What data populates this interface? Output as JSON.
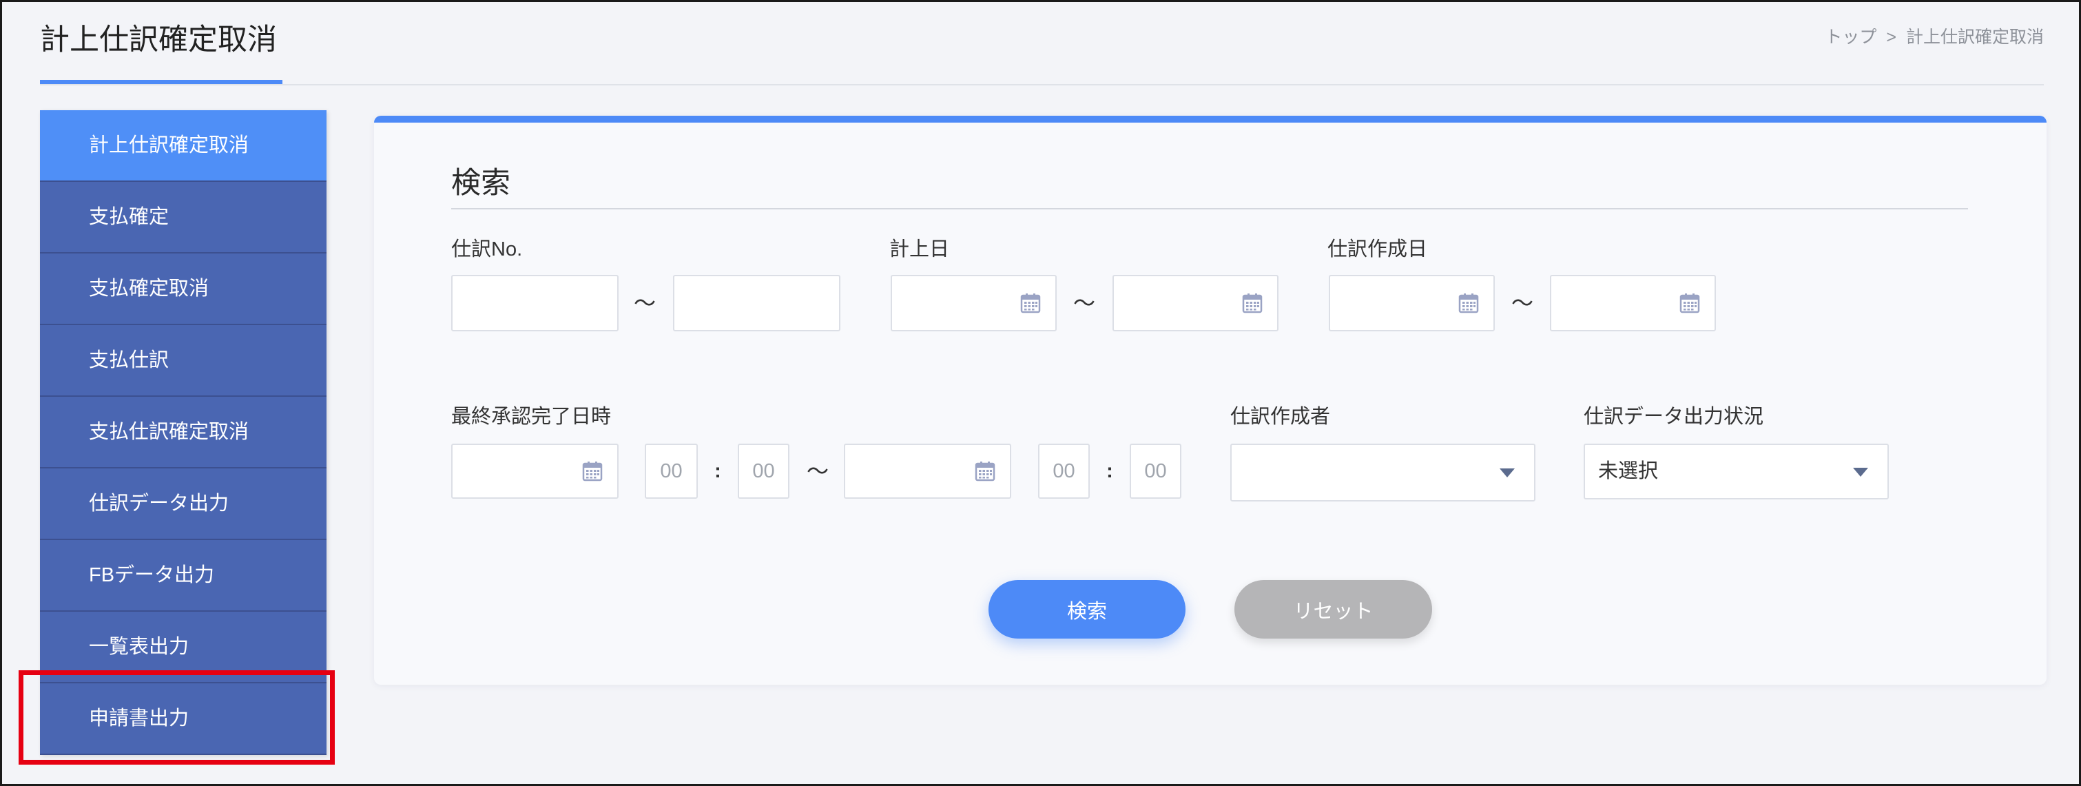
{
  "header": {
    "title": "計上仕訳確定取消",
    "breadcrumb": {
      "home": "トップ",
      "separator": ">",
      "current": "計上仕訳確定取消"
    }
  },
  "sidebar": {
    "items": [
      {
        "label": "計上仕訳確定取消",
        "active": true
      },
      {
        "label": "支払確定",
        "active": false
      },
      {
        "label": "支払確定取消",
        "active": false
      },
      {
        "label": "支払仕訳",
        "active": false
      },
      {
        "label": "支払仕訳確定取消",
        "active": false
      },
      {
        "label": "仕訳データ出力",
        "active": false
      },
      {
        "label": "FBデータ出力",
        "active": false
      },
      {
        "label": "一覧表出力",
        "active": false
      },
      {
        "label": "申請書出力",
        "active": false
      }
    ]
  },
  "search": {
    "heading": "検索",
    "range_separator": "〜",
    "time_separator": ":",
    "journal_no": {
      "label": "仕訳No.",
      "from_value": "",
      "to_value": ""
    },
    "posting_date": {
      "label": "計上日",
      "from_value": "",
      "to_value": ""
    },
    "journal_created_date": {
      "label": "仕訳作成日",
      "from_value": "",
      "to_value": ""
    },
    "final_approval_datetime": {
      "label": "最終承認完了日時",
      "from_date_value": "",
      "from_hour_placeholder": "00",
      "from_minute_placeholder": "00",
      "to_date_value": "",
      "to_hour_placeholder": "00",
      "to_minute_placeholder": "00"
    },
    "journal_creator": {
      "label": "仕訳作成者",
      "selected": ""
    },
    "output_status": {
      "label": "仕訳データ出力状況",
      "selected": "未選択"
    },
    "buttons": {
      "search": "検索",
      "reset": "リセット"
    }
  },
  "icons": {
    "date_picker": "calendar-icon",
    "dropdown": "chevron-down-icon"
  },
  "colors": {
    "accent": "#4d8af7",
    "sidebar_item": "#4a66b2",
    "sidebar_item_active": "#4f8ff7",
    "reset_button": "#b5b5b7",
    "highlight_annotation": "#e60012"
  }
}
